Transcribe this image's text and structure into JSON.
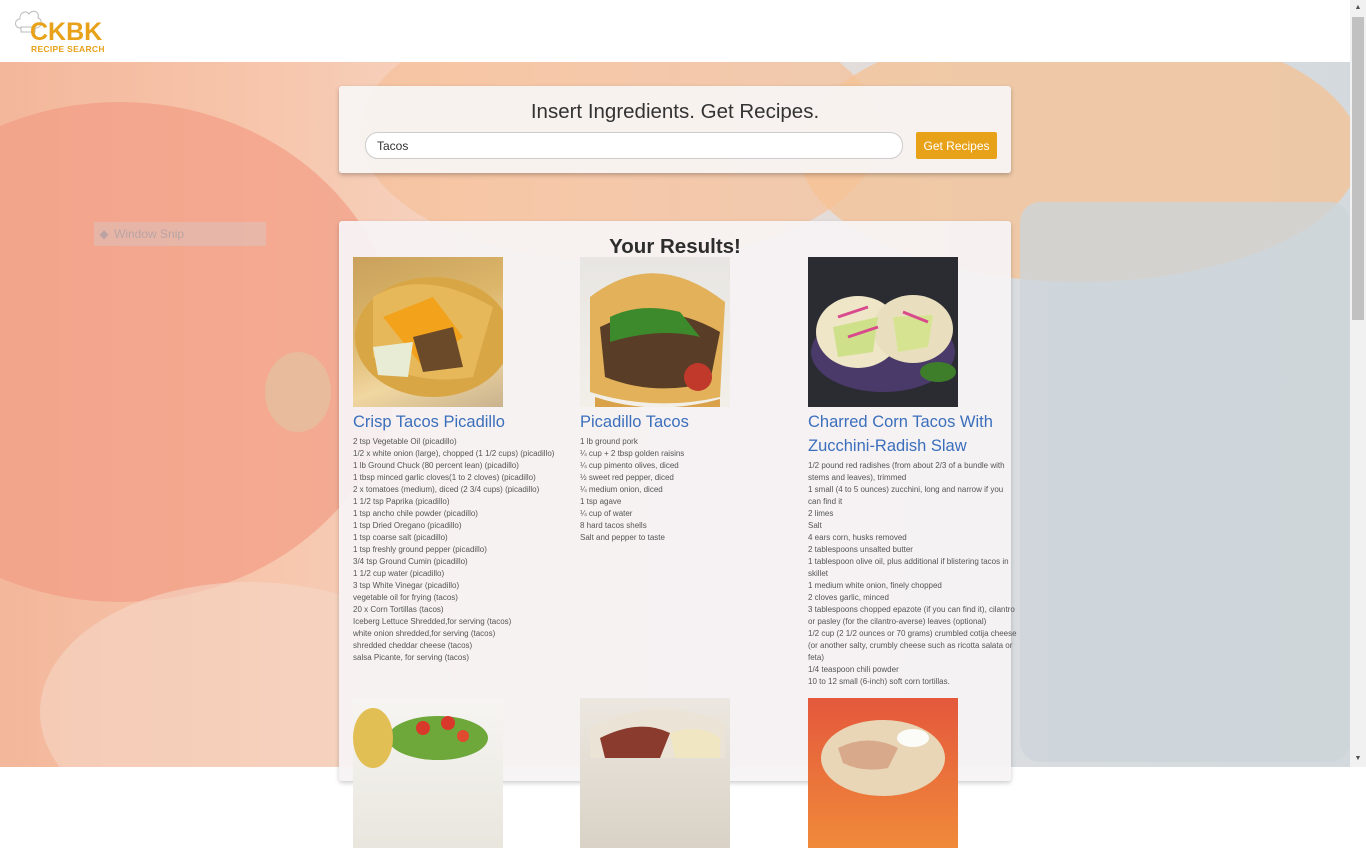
{
  "brand": {
    "logo_text": "CKBK",
    "logo_subtitle": "RECIPE SEARCH",
    "accent_color": "#e8a21a",
    "link_color": "#3b6fbc"
  },
  "ghost_overlay": {
    "label": "Window Snip"
  },
  "search": {
    "title": "Insert Ingredients. Get Recipes.",
    "input_value": "Tacos",
    "button_label": "Get Recipes"
  },
  "results": {
    "title": "Your Results!",
    "recipes": [
      {
        "title": "Crisp Tacos Picadillo",
        "image_icon": "taco-photo",
        "ingredients": [
          "2 tsp Vegetable Oil (picadillo)",
          "1/2 x white onion (large), chopped (1 1/2 cups) (picadillo)",
          "1 lb Ground Chuck (80 percent lean) (picadillo)",
          "1 tbsp minced garlic cloves(1 to 2 cloves) (picadillo)",
          "2 x tomatoes (medium), diced (2 3/4 cups) (picadillo)",
          "1 1/2 tsp Paprika (picadillo)",
          "1 tsp ancho chile powder (picadillo)",
          "1 tsp Dried Oregano (picadillo)",
          "1 tsp coarse salt (picadillo)",
          "1 tsp freshly ground pepper (picadillo)",
          "3/4 tsp Ground Cumin (picadillo)",
          "1 1/2 cup water (picadillo)",
          "3 tsp White Vinegar (picadillo)",
          "vegetable oil for frying (tacos)",
          "20 x Corn Tortillas (tacos)",
          "Iceberg Lettuce Shredded,for serving (tacos)",
          "white onion shredded,for serving (tacos)",
          "shredded cheddar cheese (tacos)",
          "salsa Picante, for serving (tacos)"
        ]
      },
      {
        "title": "Picadillo Tacos",
        "image_icon": "taco-photo",
        "ingredients": [
          "1 lb ground pork",
          "¼ cup + 2 tbsp golden raisins",
          "¼ cup pimento olives, diced",
          "½ sweet red pepper, diced",
          "¼ medium onion, diced",
          "1 tsp agave",
          "¼ cup of water",
          "8 hard tacos shells",
          "Salt and pepper to taste"
        ]
      },
      {
        "title": "Charred Corn Tacos With Zucchini-Radish Slaw",
        "image_icon": "taco-photo",
        "ingredients": [
          "1/2 pound red radishes (from about 2/3 of a bundle with stems and leaves), trimmed",
          "1 small (4 to 5 ounces) zucchini, long and narrow if you can find it",
          "2 limes",
          "Salt",
          "4 ears corn, husks removed",
          "2 tablespoons unsalted butter",
          "1 tablespoon olive oil, plus additional if blistering tacos in skillet",
          "1 medium white onion, finely chopped",
          "2 cloves garlic, minced",
          "3 tablespoons chopped epazote (if you can find it), cilantro or pasley (for the cilantro-averse) leaves (optional)",
          "1/2 cup (2 1/2 ounces or 70 grams) crumbled cotija cheese (or another salty, crumbly cheese such as ricotta salata or feta)",
          "1/4 teaspoon chili powder",
          "10 to 12 small (6-inch) soft corn tortillas."
        ]
      }
    ]
  }
}
